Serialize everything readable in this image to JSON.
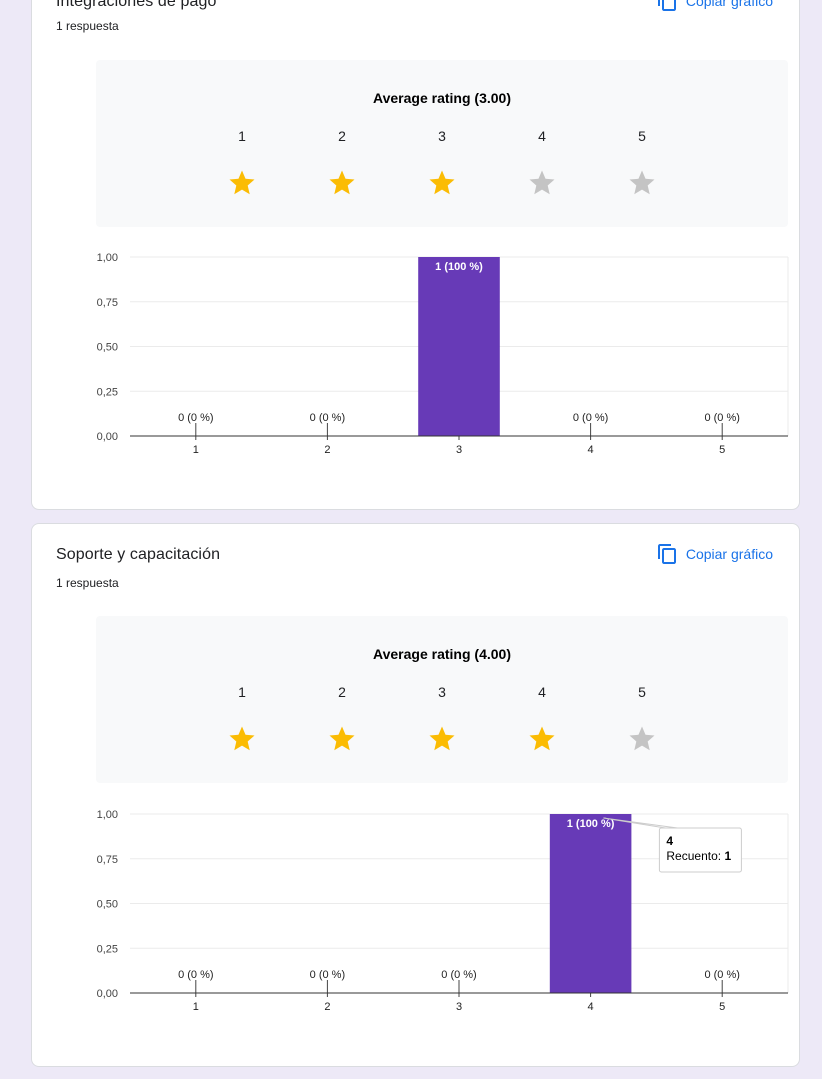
{
  "questions": [
    {
      "title": "Integraciones de pago",
      "response_count": "1 respuesta",
      "copy_label": "Copiar gráfico",
      "rating_title": "Average rating (3.00)",
      "rating_value": 3,
      "rating_max": 5,
      "star_labels": [
        "1",
        "2",
        "3",
        "4",
        "5"
      ],
      "chart_data": {
        "type": "bar",
        "categories": [
          "1",
          "2",
          "3",
          "4",
          "5"
        ],
        "values": [
          0,
          0,
          1,
          0,
          0
        ],
        "data_labels": [
          "0 (0 %)",
          "0 (0 %)",
          "1 (100 %)",
          "0 (0 %)",
          "0 (0 %)"
        ],
        "y_ticks": [
          "0,00",
          "0,25",
          "0,50",
          "0,75",
          "1,00"
        ],
        "ylim": [
          0,
          1
        ],
        "title": "",
        "xlabel": "",
        "ylabel": "",
        "bar_color": "#673ab7"
      }
    },
    {
      "title": "Soporte y capacitación",
      "response_count": "1 respuesta",
      "copy_label": "Copiar gráfico",
      "rating_title": "Average rating (4.00)",
      "rating_value": 4,
      "rating_max": 5,
      "star_labels": [
        "1",
        "2",
        "3",
        "4",
        "5"
      ],
      "chart_data": {
        "type": "bar",
        "categories": [
          "1",
          "2",
          "3",
          "4",
          "5"
        ],
        "values": [
          0,
          0,
          0,
          1,
          0
        ],
        "data_labels": [
          "0 (0 %)",
          "0 (0 %)",
          "0 (0 %)",
          "1 (100 %)",
          "0 (0 %)"
        ],
        "y_ticks": [
          "0,00",
          "0,25",
          "0,50",
          "0,75",
          "1,00"
        ],
        "ylim": [
          0,
          1
        ],
        "title": "",
        "xlabel": "",
        "ylabel": "",
        "bar_color": "#673ab7",
        "tooltip": {
          "category": "4",
          "label": "Recuento:",
          "value": "1"
        }
      }
    }
  ],
  "colors": {
    "star_filled": "#fbbc04",
    "star_empty": "#c4c4c4",
    "accent": "#1a73e8",
    "background": "#ede9f7"
  },
  "icons": {
    "copy": "copy-icon",
    "star": "star-icon"
  }
}
